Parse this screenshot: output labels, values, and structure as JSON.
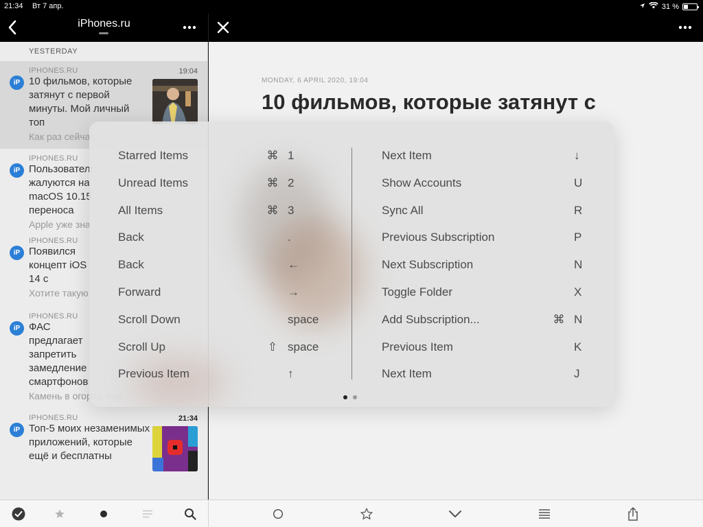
{
  "status_bar": {
    "time": "21:34",
    "date": "Вт 7 апр.",
    "battery": "31 %",
    "battery_level": 0.31
  },
  "sidebar_header": {
    "title": "iPhones.ru"
  },
  "section": {
    "label": "YESTERDAY"
  },
  "articles": [
    {
      "source": "IPHONES.RU",
      "time": "19:04",
      "badge": "iP",
      "title": "10 фильмов, которые затянут с первой минуты. Мой личный топ",
      "excerpt": "Как раз сейчас",
      "selected": true
    },
    {
      "source": "IPHONES.RU",
      "time": "",
      "badge": "iP",
      "title": "Пользователи жалуются на macOS 10.15 переноса больших файлов",
      "excerpt": "Apple уже знает",
      "selected": false
    },
    {
      "source": "IPHONES.RU",
      "time": "",
      "badge": "iP",
      "title": "Появился концепт iOS 14 с виджетами на главном экране",
      "excerpt": "Хотите такую",
      "selected": false
    },
    {
      "source": "IPHONES.RU",
      "time": "",
      "badge": "iP",
      "title": "ФАС предлагает запретить замедление смартфонов при износе аккумулятора",
      "excerpt": "Камень в огород App...",
      "selected": false
    },
    {
      "source": "IPHONES.RU",
      "time": "21:34",
      "badge": "iP",
      "title": "Топ-5 моих незаменимых приложений, которые ещё и бесплатны",
      "excerpt": "",
      "selected": false
    }
  ],
  "detail": {
    "date": "MONDAY, 6 APRIL 2020, 19:04",
    "title": "10 фильмов, которые затянут с"
  },
  "shortcuts": {
    "left": [
      {
        "label": "Starred Items",
        "modifier": "⌘",
        "key": "1"
      },
      {
        "label": "Unread Items",
        "modifier": "⌘",
        "key": "2"
      },
      {
        "label": "All Items",
        "modifier": "⌘",
        "key": "3"
      },
      {
        "label": "Back",
        "modifier": "",
        "key": "."
      },
      {
        "label": "Back",
        "modifier": "",
        "key": "←"
      },
      {
        "label": "Forward",
        "modifier": "",
        "key": "→"
      },
      {
        "label": "Scroll Down",
        "modifier": "",
        "key": "space"
      },
      {
        "label": "Scroll Up",
        "modifier": "⇧",
        "key": "space"
      },
      {
        "label": "Previous Item",
        "modifier": "",
        "key": "↑"
      }
    ],
    "right": [
      {
        "label": "Next Item",
        "modifier": "",
        "key": "↓"
      },
      {
        "label": "Show Accounts",
        "modifier": "",
        "key": "U"
      },
      {
        "label": "Sync All",
        "modifier": "",
        "key": "R"
      },
      {
        "label": "Previous Subscription",
        "modifier": "",
        "key": "P"
      },
      {
        "label": "Next Subscription",
        "modifier": "",
        "key": "N"
      },
      {
        "label": "Toggle Folder",
        "modifier": "",
        "key": "X"
      },
      {
        "label": "Add Subscription...",
        "modifier": "⌘",
        "key": "N"
      },
      {
        "label": "Previous Item",
        "modifier": "",
        "key": "K"
      },
      {
        "label": "Next Item",
        "modifier": "",
        "key": "J"
      }
    ],
    "page_index": 0,
    "page_count": 2
  },
  "colors": {
    "accent": "#2b7fd6",
    "toolbar_icon": "#555555"
  },
  "icons": {
    "sidebar_bar": [
      "chevron-left-icon",
      "more-icon"
    ],
    "detail_bar": [
      "close-icon",
      "more-icon"
    ],
    "sidebar_toolbar": [
      "checkmark-circle-icon",
      "star-icon",
      "dot-icon",
      "list-icon",
      "search-icon"
    ],
    "detail_toolbar": [
      "circle-icon",
      "star-outline-icon",
      "chevron-down-icon",
      "text-lines-icon",
      "share-icon"
    ]
  }
}
